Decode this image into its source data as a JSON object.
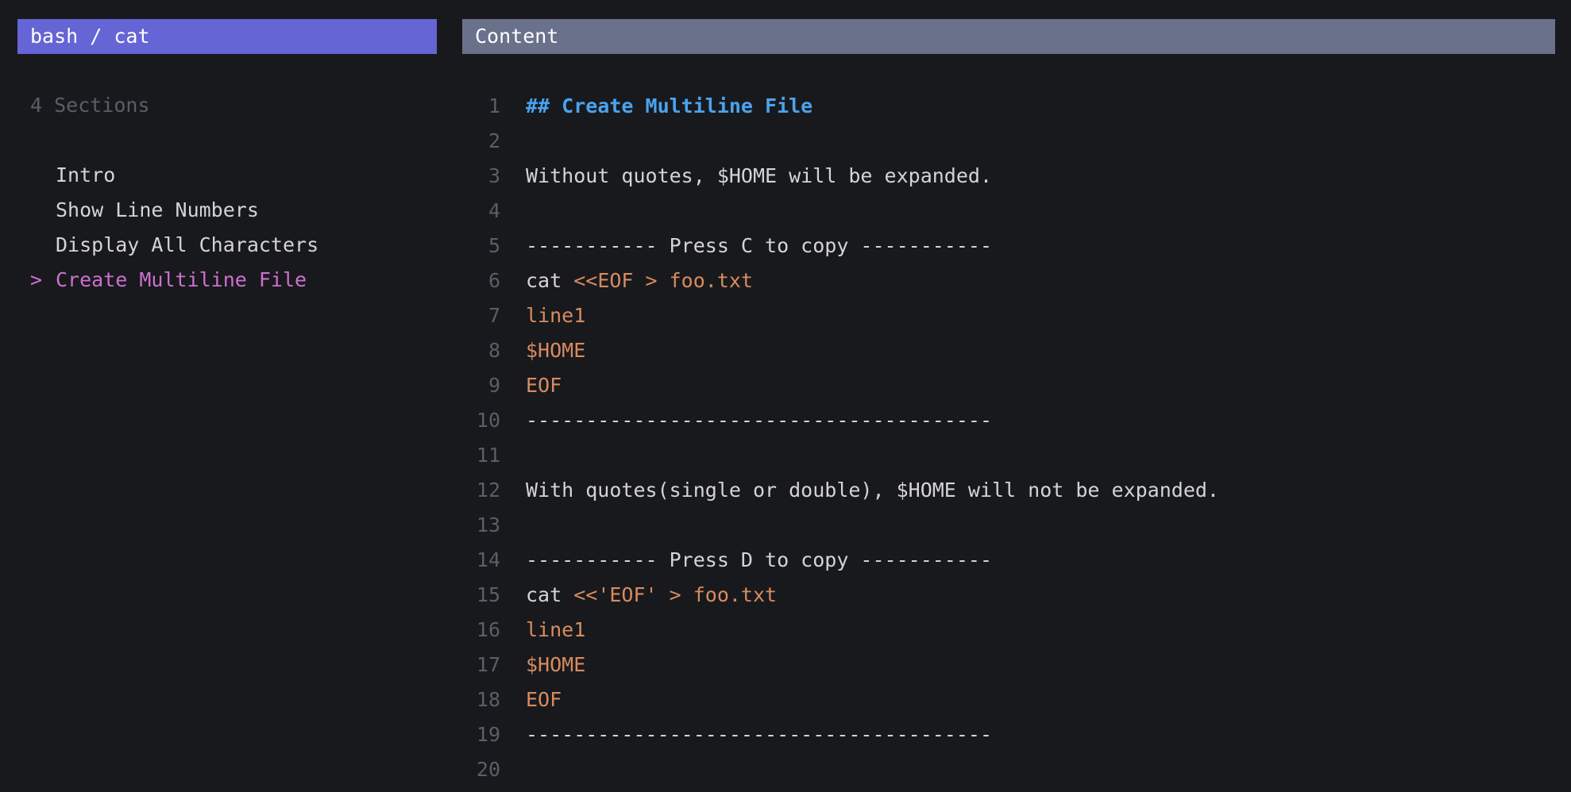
{
  "left_pane": {
    "title": "bash / cat",
    "sections_count": "4 Sections",
    "items": [
      {
        "marker": "",
        "label": "Intro",
        "selected": false
      },
      {
        "marker": "",
        "label": "Show Line Numbers",
        "selected": false
      },
      {
        "marker": "",
        "label": "Display All Characters",
        "selected": false
      },
      {
        "marker": ">",
        "label": "Create Multiline File",
        "selected": true
      }
    ]
  },
  "right_pane": {
    "title": "Content",
    "lines": [
      {
        "no": "1",
        "segments": [
          {
            "text": "## Create Multiline File",
            "kind": "heading"
          }
        ]
      },
      {
        "no": "2",
        "segments": []
      },
      {
        "no": "3",
        "segments": [
          {
            "text": "Without quotes, $HOME will be expanded.",
            "kind": "plain"
          }
        ]
      },
      {
        "no": "4",
        "segments": []
      },
      {
        "no": "5",
        "segments": [
          {
            "text": "----------- Press C to copy -----------",
            "kind": "plain"
          }
        ]
      },
      {
        "no": "6",
        "segments": [
          {
            "text": "cat ",
            "kind": "plain"
          },
          {
            "text": "<<EOF > foo.txt",
            "kind": "string"
          }
        ]
      },
      {
        "no": "7",
        "segments": [
          {
            "text": "line1",
            "kind": "string"
          }
        ]
      },
      {
        "no": "8",
        "segments": [
          {
            "text": "$HOME",
            "kind": "string"
          }
        ]
      },
      {
        "no": "9",
        "segments": [
          {
            "text": "EOF",
            "kind": "string"
          }
        ]
      },
      {
        "no": "10",
        "segments": [
          {
            "text": "---------------------------------------",
            "kind": "plain"
          }
        ]
      },
      {
        "no": "11",
        "segments": []
      },
      {
        "no": "12",
        "segments": [
          {
            "text": "With quotes(single or double), $HOME will not be expanded.",
            "kind": "plain"
          }
        ]
      },
      {
        "no": "13",
        "segments": []
      },
      {
        "no": "14",
        "segments": [
          {
            "text": "----------- Press D to copy -----------",
            "kind": "plain"
          }
        ]
      },
      {
        "no": "15",
        "segments": [
          {
            "text": "cat ",
            "kind": "plain"
          },
          {
            "text": "<<'EOF' > foo.txt",
            "kind": "string"
          }
        ]
      },
      {
        "no": "16",
        "segments": [
          {
            "text": "line1",
            "kind": "string"
          }
        ]
      },
      {
        "no": "17",
        "segments": [
          {
            "text": "$HOME",
            "kind": "string"
          }
        ]
      },
      {
        "no": "18",
        "segments": [
          {
            "text": "EOF",
            "kind": "string"
          }
        ]
      },
      {
        "no": "19",
        "segments": [
          {
            "text": "---------------------------------------",
            "kind": "plain"
          }
        ]
      },
      {
        "no": "20",
        "segments": []
      }
    ]
  },
  "colors": {
    "background": "#18191d",
    "left_header": "#6565d6",
    "right_header": "#69728a",
    "selected_item": "#cf6fd0",
    "heading": "#4aa3ee",
    "string": "#d88b5f",
    "muted": "#5b5e66",
    "text": "#d4d4d8"
  }
}
